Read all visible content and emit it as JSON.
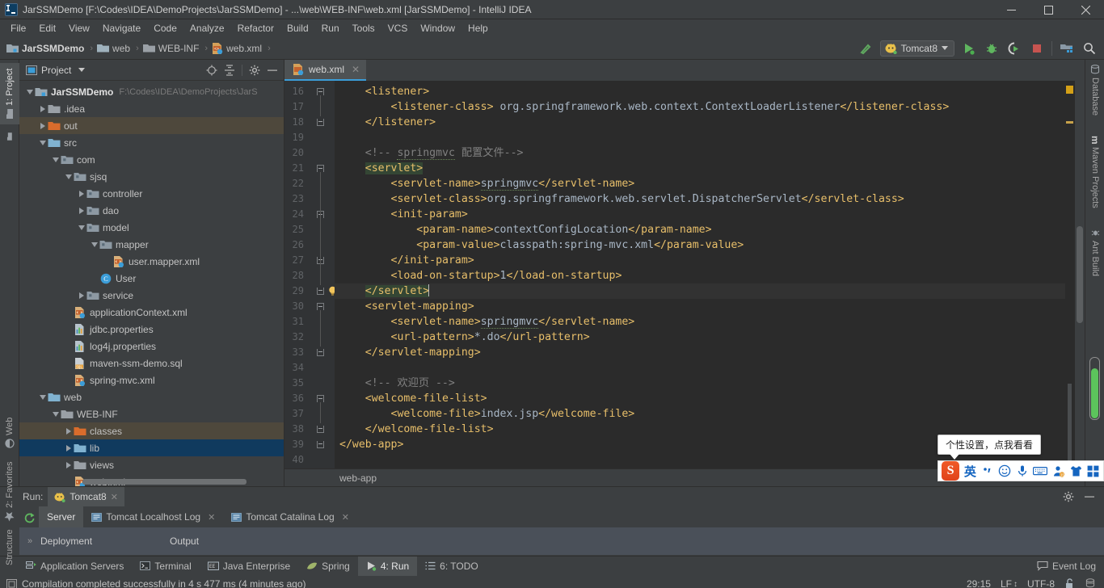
{
  "window": {
    "title": "JarSSMDemo [F:\\Codes\\IDEA\\DemoProjects\\JarSSMDemo] - ...\\web\\WEB-INF\\web.xml [JarSSMDemo] - IntelliJ IDEA",
    "app_badge": "IJ",
    "minimize": "—",
    "maximize": "❐",
    "close": "✕"
  },
  "menu": {
    "items": [
      "File",
      "Edit",
      "View",
      "Navigate",
      "Code",
      "Analyze",
      "Refactor",
      "Build",
      "Run",
      "Tools",
      "VCS",
      "Window",
      "Help"
    ]
  },
  "navbar": {
    "breadcrumbs": [
      {
        "label": "JarSSMDemo",
        "icon": "module-icon"
      },
      {
        "label": "web",
        "icon": "folder-icon"
      },
      {
        "label": "WEB-INF",
        "icon": "folder-icon"
      },
      {
        "label": "web.xml",
        "icon": "xml-file-icon"
      }
    ],
    "separator": "›",
    "run_config": "Tomcat8",
    "icons": [
      "build-hammer-icon",
      "run-icon",
      "debug-icon",
      "run-coverage-icon",
      "stop-icon",
      "project-structure-icon",
      "search-icon"
    ]
  },
  "left_strip": {
    "tabs": [
      {
        "label": "1: Project",
        "active": true,
        "icon": "project-icon"
      },
      {
        "label": "Web",
        "active": false,
        "icon": "web-icon"
      },
      {
        "label": "2: Favorites",
        "active": false,
        "icon": "star-icon"
      },
      {
        "label": "Structure",
        "active": false,
        "icon": "structure-icon"
      }
    ]
  },
  "right_strip": {
    "tabs": [
      {
        "label": "Database",
        "icon": "database-icon"
      },
      {
        "label": "Maven Projects",
        "icon": "maven-icon"
      },
      {
        "label": "Ant Build",
        "icon": "ant-icon"
      }
    ]
  },
  "project_panel": {
    "title": "Project",
    "toolbar_icons": [
      "target-locate-icon",
      "collapse-all-icon",
      "gear-icon",
      "hide-icon"
    ],
    "tree": [
      {
        "indent": 0,
        "arrow": "down",
        "icon": "module-icon",
        "label": "JarSSMDemo",
        "bold": true,
        "path": "F:\\Codes\\IDEA\\DemoProjects\\JarS",
        "state": "normal"
      },
      {
        "indent": 1,
        "arrow": "right",
        "icon": "folder-gray-icon",
        "label": ".idea",
        "bold": false,
        "path": "",
        "state": "normal"
      },
      {
        "indent": 1,
        "arrow": "right",
        "icon": "folder-orange-icon",
        "label": "out",
        "bold": false,
        "path": "",
        "state": "highlight"
      },
      {
        "indent": 1,
        "arrow": "down",
        "icon": "folder-blue-icon",
        "label": "src",
        "bold": false,
        "path": "",
        "state": "normal"
      },
      {
        "indent": 2,
        "arrow": "down",
        "icon": "package-icon",
        "label": "com",
        "bold": false,
        "path": "",
        "state": "normal"
      },
      {
        "indent": 3,
        "arrow": "down",
        "icon": "package-icon",
        "label": "sjsq",
        "bold": false,
        "path": "",
        "state": "normal"
      },
      {
        "indent": 4,
        "arrow": "right",
        "icon": "package-icon",
        "label": "controller",
        "bold": false,
        "path": "",
        "state": "normal"
      },
      {
        "indent": 4,
        "arrow": "right",
        "icon": "package-icon",
        "label": "dao",
        "bold": false,
        "path": "",
        "state": "normal"
      },
      {
        "indent": 4,
        "arrow": "down",
        "icon": "package-icon",
        "label": "model",
        "bold": false,
        "path": "",
        "state": "normal"
      },
      {
        "indent": 5,
        "arrow": "down",
        "icon": "package-icon",
        "label": "mapper",
        "bold": false,
        "path": "",
        "state": "normal"
      },
      {
        "indent": 6,
        "arrow": "none",
        "icon": "xml-file-icon",
        "label": "user.mapper.xml",
        "bold": false,
        "path": "",
        "state": "normal"
      },
      {
        "indent": 5,
        "arrow": "none",
        "icon": "class-icon",
        "label": "User",
        "bold": false,
        "path": "",
        "state": "normal"
      },
      {
        "indent": 4,
        "arrow": "right",
        "icon": "package-icon",
        "label": "service",
        "bold": false,
        "path": "",
        "state": "normal"
      },
      {
        "indent": 3,
        "arrow": "none",
        "icon": "xml-file-icon",
        "label": "applicationContext.xml",
        "bold": false,
        "path": "",
        "state": "normal"
      },
      {
        "indent": 3,
        "arrow": "none",
        "icon": "properties-icon",
        "label": "jdbc.properties",
        "bold": false,
        "path": "",
        "state": "normal"
      },
      {
        "indent": 3,
        "arrow": "none",
        "icon": "properties-icon",
        "label": "log4j.properties",
        "bold": false,
        "path": "",
        "state": "normal"
      },
      {
        "indent": 3,
        "arrow": "none",
        "icon": "sql-file-icon",
        "label": "maven-ssm-demo.sql",
        "bold": false,
        "path": "",
        "state": "normal"
      },
      {
        "indent": 3,
        "arrow": "none",
        "icon": "xml-file-icon",
        "label": "spring-mvc.xml",
        "bold": false,
        "path": "",
        "state": "normal"
      },
      {
        "indent": 1,
        "arrow": "down",
        "icon": "folder-blue-icon",
        "label": "web",
        "bold": false,
        "path": "",
        "state": "normal"
      },
      {
        "indent": 2,
        "arrow": "down",
        "icon": "folder-gray-icon",
        "label": "WEB-INF",
        "bold": false,
        "path": "",
        "state": "normal"
      },
      {
        "indent": 3,
        "arrow": "right",
        "icon": "folder-orange-icon",
        "label": "classes",
        "bold": false,
        "path": "",
        "state": "highlight"
      },
      {
        "indent": 3,
        "arrow": "right",
        "icon": "folder-blue-icon",
        "label": "lib",
        "bold": false,
        "path": "",
        "state": "selected"
      },
      {
        "indent": 3,
        "arrow": "right",
        "icon": "folder-gray-icon",
        "label": "views",
        "bold": false,
        "path": "",
        "state": "normal"
      },
      {
        "indent": 3,
        "arrow": "none",
        "icon": "xml-file-icon",
        "label": "web.xml",
        "bold": false,
        "path": "",
        "state": "normal"
      }
    ]
  },
  "editor": {
    "tab": {
      "label": "web.xml",
      "icon": "xml-file-icon",
      "close": "✕"
    },
    "breadcrumb": "web-app",
    "first_line_number": 16,
    "lines": [
      {
        "n": 16,
        "fold": "start",
        "indent": 4,
        "current": false,
        "spans": [
          {
            "t": "<listener>",
            "c": "tag"
          }
        ]
      },
      {
        "n": 17,
        "fold": "none",
        "indent": 8,
        "current": false,
        "spans": [
          {
            "t": "<listener-class>",
            "c": "tag"
          },
          {
            "t": " org.springframework.web.context.ContextLoaderListener",
            "c": "txt"
          },
          {
            "t": "</listener-class>",
            "c": "tag"
          }
        ]
      },
      {
        "n": 18,
        "fold": "end",
        "indent": 4,
        "current": false,
        "spans": [
          {
            "t": "</listener>",
            "c": "tag"
          }
        ]
      },
      {
        "n": 19,
        "fold": "none",
        "indent": 0,
        "current": false,
        "spans": []
      },
      {
        "n": 20,
        "fold": "none",
        "indent": 4,
        "current": false,
        "spans": [
          {
            "t": "<!-- ",
            "c": "cmt"
          },
          {
            "t": "springmvc",
            "c": "cmt typo"
          },
          {
            "t": " 配置文件-->",
            "c": "cmt"
          }
        ]
      },
      {
        "n": 21,
        "fold": "start",
        "indent": 4,
        "current": false,
        "spans": [
          {
            "t": "<servlet>",
            "c": "tag hl"
          }
        ]
      },
      {
        "n": 22,
        "fold": "none",
        "indent": 8,
        "current": false,
        "spans": [
          {
            "t": "<servlet-name>",
            "c": "tag"
          },
          {
            "t": "springmvc",
            "c": "txt typo"
          },
          {
            "t": "</servlet-name>",
            "c": "tag"
          }
        ]
      },
      {
        "n": 23,
        "fold": "none",
        "indent": 8,
        "current": false,
        "spans": [
          {
            "t": "<servlet-class>",
            "c": "tag"
          },
          {
            "t": "org.springframework.web.servlet.DispatcherServlet",
            "c": "txt"
          },
          {
            "t": "</servlet-class>",
            "c": "tag"
          }
        ]
      },
      {
        "n": 24,
        "fold": "start",
        "indent": 8,
        "current": false,
        "spans": [
          {
            "t": "<init-param>",
            "c": "tag"
          }
        ]
      },
      {
        "n": 25,
        "fold": "none",
        "indent": 12,
        "current": false,
        "spans": [
          {
            "t": "<param-name>",
            "c": "tag"
          },
          {
            "t": "contextConfigLocation",
            "c": "txt"
          },
          {
            "t": "</param-name>",
            "c": "tag"
          }
        ]
      },
      {
        "n": 26,
        "fold": "none",
        "indent": 12,
        "current": false,
        "spans": [
          {
            "t": "<param-value>",
            "c": "tag"
          },
          {
            "t": "classpath:spring-mvc.xml",
            "c": "txt"
          },
          {
            "t": "</param-value>",
            "c": "tag"
          }
        ]
      },
      {
        "n": 27,
        "fold": "end",
        "indent": 8,
        "current": false,
        "spans": [
          {
            "t": "</init-param>",
            "c": "tag"
          }
        ]
      },
      {
        "n": 28,
        "fold": "none",
        "indent": 8,
        "current": false,
        "spans": [
          {
            "t": "<load-on-startup>",
            "c": "tag"
          },
          {
            "t": "1",
            "c": "txt"
          },
          {
            "t": "</load-on-startup>",
            "c": "tag"
          }
        ]
      },
      {
        "n": 29,
        "fold": "end",
        "indent": 4,
        "current": true,
        "bulb": true,
        "spans": [
          {
            "t": "</servlet>",
            "c": "tag hl"
          }
        ],
        "caret": true
      },
      {
        "n": 30,
        "fold": "start",
        "indent": 4,
        "current": false,
        "spans": [
          {
            "t": "<servlet-mapping>",
            "c": "tag"
          }
        ]
      },
      {
        "n": 31,
        "fold": "none",
        "indent": 8,
        "current": false,
        "spans": [
          {
            "t": "<servlet-name>",
            "c": "tag"
          },
          {
            "t": "springmvc",
            "c": "txt typo"
          },
          {
            "t": "</servlet-name>",
            "c": "tag"
          }
        ]
      },
      {
        "n": 32,
        "fold": "none",
        "indent": 8,
        "current": false,
        "spans": [
          {
            "t": "<url-pattern>",
            "c": "tag"
          },
          {
            "t": "*.do",
            "c": "txt"
          },
          {
            "t": "</url-pattern>",
            "c": "tag"
          }
        ]
      },
      {
        "n": 33,
        "fold": "end",
        "indent": 4,
        "current": false,
        "spans": [
          {
            "t": "</servlet-mapping>",
            "c": "tag"
          }
        ]
      },
      {
        "n": 34,
        "fold": "none",
        "indent": 0,
        "current": false,
        "spans": []
      },
      {
        "n": 35,
        "fold": "none",
        "indent": 4,
        "current": false,
        "spans": [
          {
            "t": "<!-- 欢迎页 -->",
            "c": "cmt"
          }
        ]
      },
      {
        "n": 36,
        "fold": "start",
        "indent": 4,
        "current": false,
        "spans": [
          {
            "t": "<welcome-file-list>",
            "c": "tag"
          }
        ]
      },
      {
        "n": 37,
        "fold": "none",
        "indent": 8,
        "current": false,
        "spans": [
          {
            "t": "<welcome-file>",
            "c": "tag"
          },
          {
            "t": "index.jsp",
            "c": "txt"
          },
          {
            "t": "</welcome-file>",
            "c": "tag"
          }
        ]
      },
      {
        "n": 38,
        "fold": "end",
        "indent": 4,
        "current": false,
        "spans": [
          {
            "t": "</welcome-file-list>",
            "c": "tag"
          }
        ]
      },
      {
        "n": 39,
        "fold": "end",
        "indent": 0,
        "current": false,
        "spans": [
          {
            "t": "</web-app>",
            "c": "tag"
          }
        ]
      },
      {
        "n": 40,
        "fold": "none",
        "indent": 0,
        "current": false,
        "spans": []
      }
    ]
  },
  "run_window": {
    "label": "Run:",
    "config_tab": "Tomcat8",
    "config_tab_close": "✕",
    "tabs": [
      {
        "label": "Server",
        "active": true,
        "icon": "",
        "closeable": false
      },
      {
        "label": "Tomcat Localhost Log",
        "active": false,
        "icon": "log-icon",
        "closeable": true
      },
      {
        "label": "Tomcat Catalina Log",
        "active": false,
        "icon": "log-icon",
        "closeable": true
      }
    ],
    "close_glyph": "✕",
    "content": {
      "expander": "»",
      "col1": "Deployment",
      "col2": "Output"
    },
    "header_icons": [
      "settings-gear-icon",
      "hide-icon"
    ],
    "rerun_icon": "rerun-icon"
  },
  "bottom_tabs": {
    "items": [
      {
        "label": "Application Servers",
        "icon": "app-servers-icon",
        "active": false
      },
      {
        "label": "Terminal",
        "icon": "terminal-icon",
        "active": false
      },
      {
        "label": "Java Enterprise",
        "icon": "java-ee-icon",
        "active": false
      },
      {
        "label": "Spring",
        "icon": "spring-leaf-icon",
        "active": false
      },
      {
        "label": "4: Run",
        "icon": "run-icon",
        "active": true
      },
      {
        "label": "6: TODO",
        "icon": "todo-icon",
        "active": false
      }
    ],
    "event_log": "Event Log",
    "event_log_icon": "event-log-icon"
  },
  "statusbar": {
    "message": "Compilation completed successfully in 4 s 477 ms (4 minutes ago)",
    "message_icon": "inspection-icon",
    "caret_position": "29:15",
    "line_separator": "LF",
    "line_separator_arrows": "↕",
    "encoding": "UTF-8",
    "lock_icon": "unlocked-icon",
    "extra_icon": "db-hammer-icon"
  },
  "ime": {
    "tooltip": "个性设置，点我看看",
    "logo": "S",
    "items": [
      {
        "name": "language-mode",
        "glyph": "英"
      },
      {
        "name": "punctuation-mode",
        "glyph": "，"
      },
      {
        "name": "emoji-icon",
        "glyph": "☺"
      },
      {
        "name": "voice-input-icon",
        "glyph": "ƨ"
      },
      {
        "name": "soft-keyboard-icon",
        "glyph": "⌨"
      },
      {
        "name": "user-center-icon",
        "glyph": "♟"
      },
      {
        "name": "skin-icon",
        "glyph": "Ŧ"
      },
      {
        "name": "toolbox-icon",
        "glyph": "⊞"
      }
    ]
  },
  "colors": {
    "accent": "#3b9dd8",
    "selected_row": "#103a5e",
    "highlight_row": "#4e483c",
    "editor_bg": "#2b2b2b",
    "tag": "#e8bf6a",
    "text": "#a9b7c6",
    "comment": "#808080"
  }
}
